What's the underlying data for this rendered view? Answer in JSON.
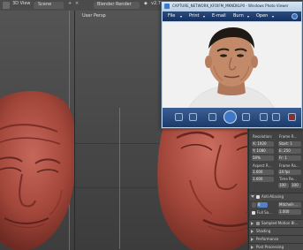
{
  "blender": {
    "header": {
      "editor_type": "3D View",
      "scene_label": "Scene",
      "render_engine": "Blender Render",
      "version": "v2.70"
    },
    "left_viewport": {
      "label": ""
    },
    "right_viewport": {
      "label": "User Persp"
    },
    "properties": {
      "resolution_label": "Resolution:",
      "res_x": "X: 1920",
      "res_y": "Y: 1080",
      "res_pct": "50%",
      "frame_range_label": "Frame R...",
      "start": "Start: 1",
      "end": "E: 250",
      "frame": "Fr: 1",
      "aspect_label": "Aspect R...",
      "aspect_x": "1.000",
      "aspect_y": "1.000",
      "frame_rate_label": "Frame Ra...",
      "fps": "24 fps",
      "time_remap": "Time Re...",
      "old": "100",
      "new": "100",
      "anti_aliasing": "Anti-Aliasing",
      "aa_samples": "8",
      "aa_filter": "Mitchell-...",
      "full_sample": "Full Sa...",
      "aa_size": "1.000",
      "sampled_motion_blur": "Sampled Motion Bl...",
      "shading": "Shading",
      "performance": "Performance",
      "post_processing": "Post Processing"
    }
  },
  "photo_viewer": {
    "title": "CAPTURE_NETWORK_KFOIFM_MKNDKLP0 - Windows Photo Viewer",
    "menu": [
      "File",
      "Print",
      "E-mail",
      "Burn",
      "Open"
    ],
    "help_icon": "help-icon"
  },
  "colors": {
    "sculpt_clay": "#a4473b",
    "viewer_bar": "#1d3a6b",
    "viewport_bg": "#4a4a4a"
  }
}
